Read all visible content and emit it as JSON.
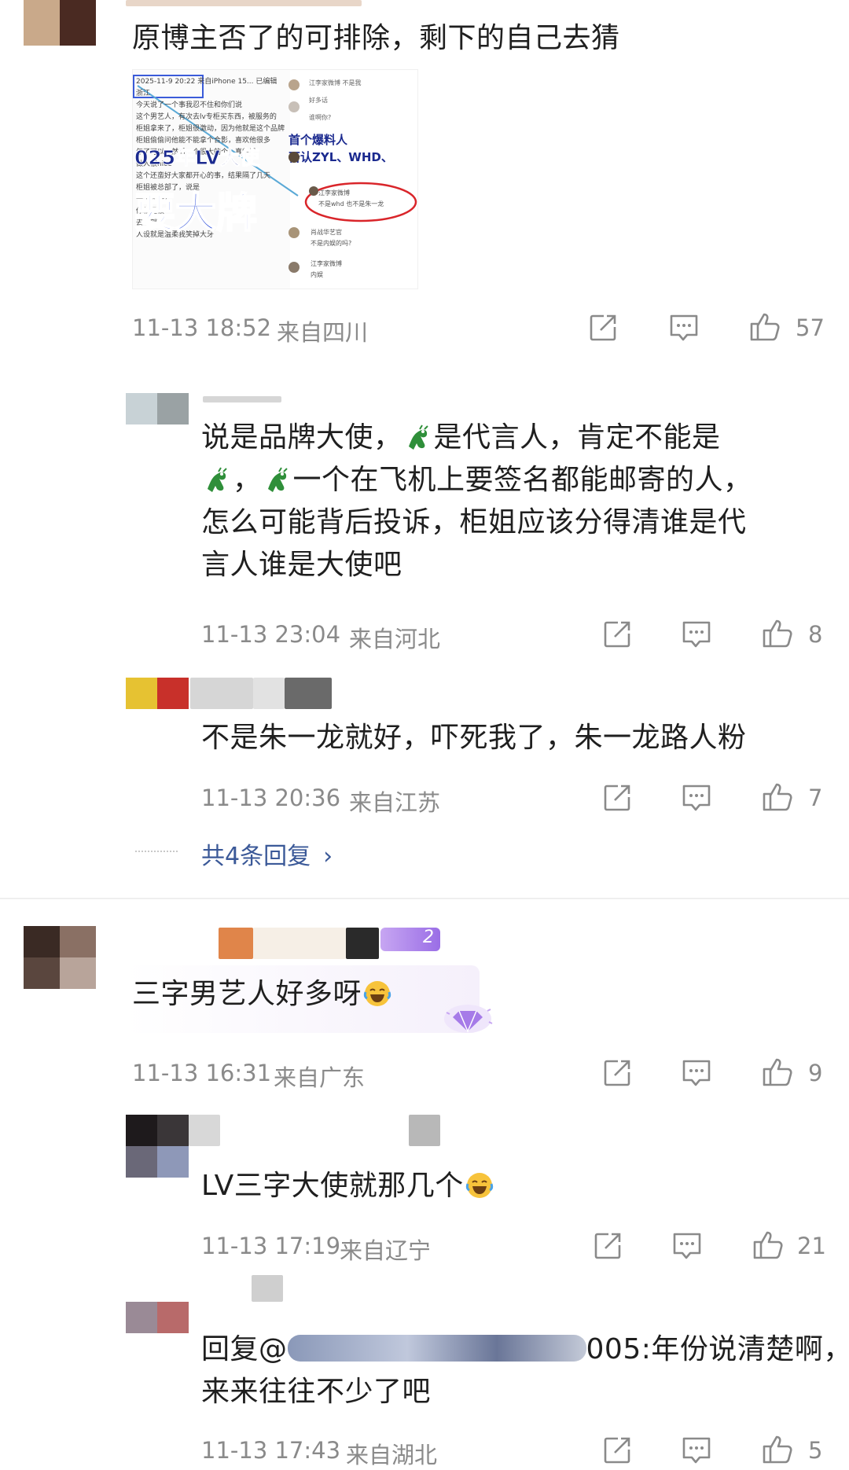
{
  "colors": {
    "text": "#1f1f1f",
    "meta": "#8a8a8a",
    "link": "#3b5998",
    "accent_purple": "#8b5cf6"
  },
  "comments": [
    {
      "text": "原博主否了的可排除，剩下的自己去猜",
      "time": "11-13 18:52",
      "location": "来自四川",
      "likes": "57",
      "image": {
        "left_lines": [
          "2025-11-9 20:22 来自iPhone 15... 已编辑",
          "浙江",
          "今天说了一个事我忍不住和你们说",
          "这个男艺人，有次去lv专柜买东西，被服务的",
          "柜姐拿来了，柜姐很激动，因为他就是这个品牌",
          "柜姐偷偷问他能不能拿个合影，喜欢他很多",
          "年了可以，然后一个很大的个，真的是",
          "做人很nice",
          "这个还蛮好大家都开心的事，结果隔了几天",
          "柜姐被总部了，说是",
          "一个大哥?",
          "你就是被",
          "去总部",
          "人设就是温柔我笑掉大牙"
        ],
        "headline1": "025年LV大使",
        "headline2": "要大牌",
        "right_lines": [
          "江李家微博 不是我",
          "好多话",
          "谁啊你?",
          "首个爆料人",
          "否认ZYL、WHD、",
          "江李家微博",
          "不是whd 也不是朱一龙",
          "肖战华艺官",
          "不是内娱的吗?",
          "江李家微博",
          "内娱"
        ],
        "overlay_title": "首个爆料人",
        "overlay_sub": "否认ZYL、WHD、"
      },
      "replies": [
        {
          "text_parts": [
            "说是品牌大使，",
            "是代言人，肯定不能是",
            "，",
            "一个在飞机上要签名都能邮寄的人，怎么可能背后投诉，柜姐应该分得清谁是代言人谁是大使吧"
          ],
          "line1": "说是品牌大使，",
          "line1b": "是代言人，肯定不能是",
          "line2b": "，",
          "line2c": "一个在飞机上要签名都能邮寄的人，",
          "line3": "怎么可能背后投诉，柜姐应该分得清谁是代",
          "line4": "言人谁是大使吧",
          "time": "11-13 23:04",
          "location": "来自河北",
          "likes": "8"
        },
        {
          "text": "不是朱一龙就好，吓死我了，朱一龙路人粉",
          "time": "11-13 20:36",
          "location": "来自江苏",
          "likes": "7"
        }
      ],
      "more_replies": "共4条回复"
    },
    {
      "text": "三字男艺人好多呀",
      "time": "11-13 16:31",
      "location": "来自广东",
      "likes": "9",
      "badge": "2",
      "replies": [
        {
          "text": "LV三字大使就那几个",
          "time": "11-13 17:19",
          "location": "来自辽宁",
          "likes": "21"
        },
        {
          "prefix": "回复@",
          "suffix": "005:年份说清楚啊，",
          "line2": "来来往往不少了吧",
          "time": "11-13 17:43",
          "location": "来自湖北",
          "likes": "5"
        }
      ]
    }
  ]
}
